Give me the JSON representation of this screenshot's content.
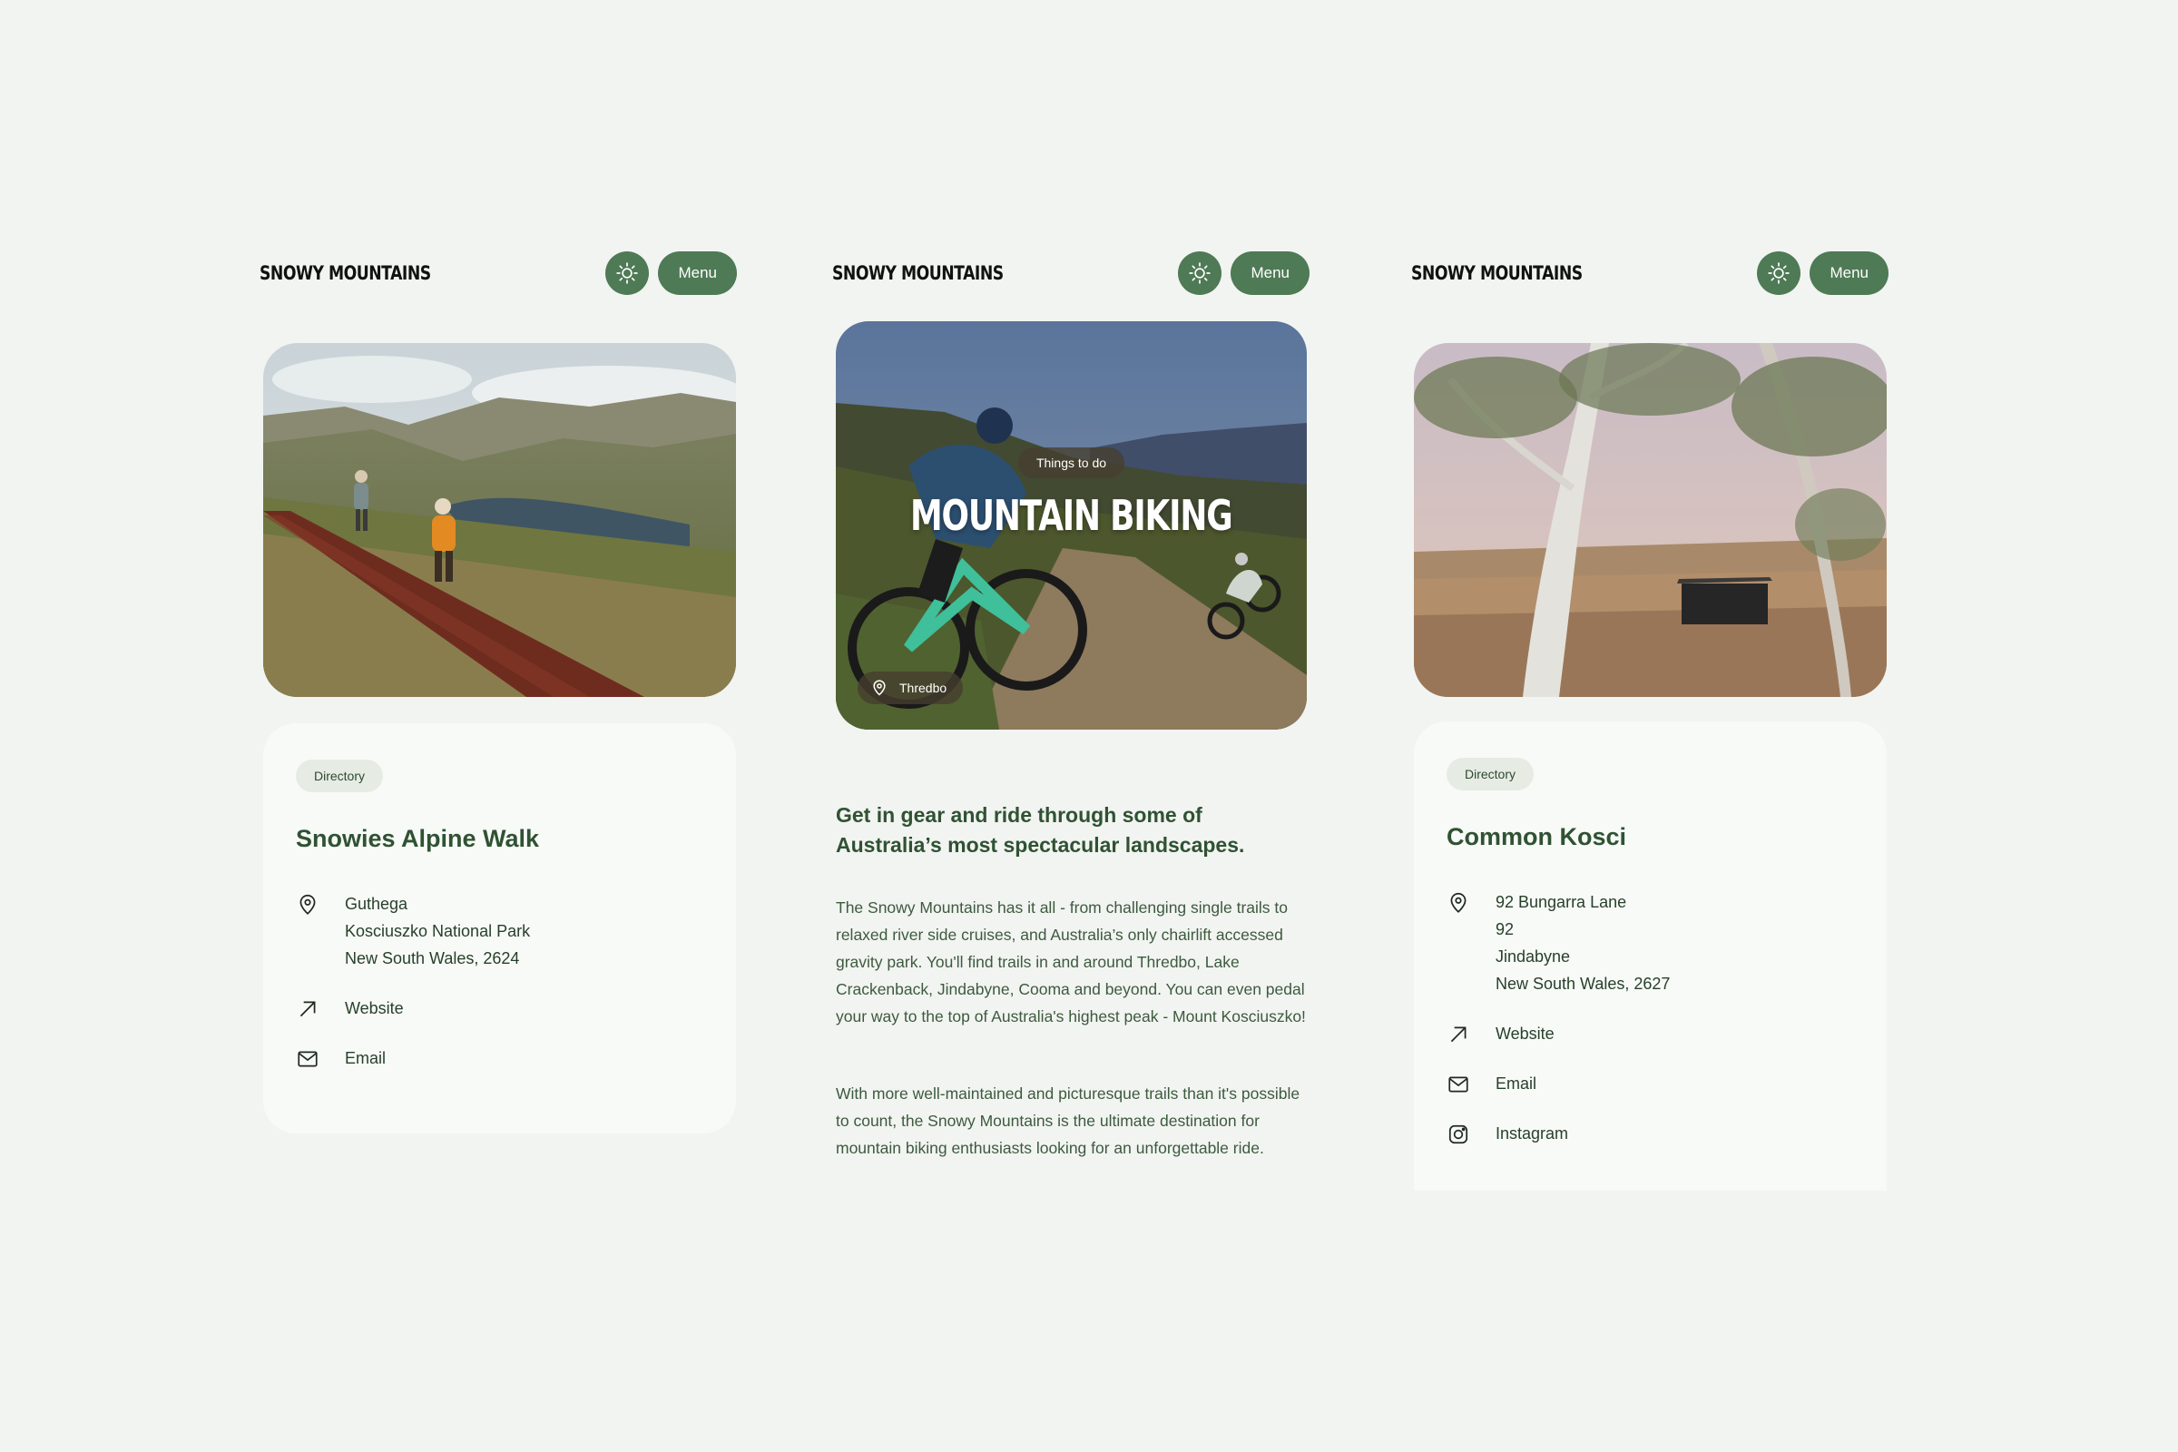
{
  "brand": "SNOWY MOUNTAINS",
  "menu_label": "Menu",
  "icons": {
    "theme": "sun-icon",
    "location": "map-pin-icon",
    "website": "arrow-up-right-icon",
    "email": "mail-icon",
    "instagram": "instagram-icon"
  },
  "colors": {
    "background": "#f2f4f1",
    "accent": "#4e7a55",
    "heading": "#2f5233",
    "card": "#f8faf7"
  },
  "panel1": {
    "chip": "Directory",
    "title": "Snowies Alpine Walk",
    "address": [
      "Guthega",
      "Kosciuszko National Park",
      "New South Wales, 2624"
    ],
    "website": "Website",
    "email": "Email"
  },
  "panel2": {
    "tag": "Things to do",
    "hero_title": "MOUNTAIN BIKING",
    "location": "Thredbo",
    "lead": "Get in gear and ride through some of Australia’s most spectacular landscapes.",
    "paragraph1": "The Snowy Mountains has it all - from challenging single trails to relaxed river side cruises, and Australia’s only chairlift accessed gravity park. You'll find trails in and around Thredbo, Lake Crackenback, Jindabyne, Cooma and beyond. You can even pedal your way to the top of Australia's highest peak - Mount Kosciuszko!",
    "paragraph2": "With more well-maintained and picturesque trails than it's possible to count, the Snowy Mountains is the ultimate destination for mountain biking enthusiasts looking for an unforgettable ride."
  },
  "panel3": {
    "chip": "Directory",
    "title": "Common Kosci",
    "address": [
      "92 Bungarra Lane",
      "92",
      "Jindabyne",
      "New South Wales, 2627"
    ],
    "website": "Website",
    "email": "Email",
    "instagram": "Instagram"
  }
}
